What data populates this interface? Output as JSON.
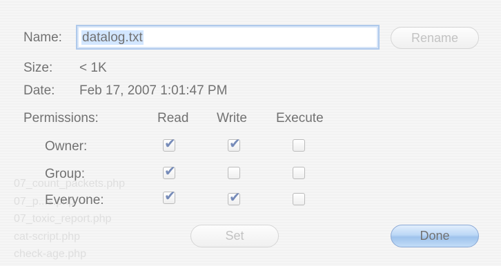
{
  "dialog": {
    "name_label": "Name:",
    "name_value": "datalog.txt",
    "rename_label": "Rename",
    "size_label": "Size:",
    "size_value": "< 1K",
    "date_label": "Date:",
    "date_value": "Feb 17, 2007 1:01:47 PM",
    "permissions_label": "Permissions:",
    "columns": [
      "Read",
      "Write",
      "Execute"
    ],
    "rows": [
      {
        "label": "Owner:",
        "read": true,
        "write": true,
        "execute": false
      },
      {
        "label": "Group:",
        "read": true,
        "write": false,
        "execute": false
      },
      {
        "label": "Everyone:",
        "read": true,
        "write": true,
        "execute": false
      }
    ],
    "set_label": "Set",
    "done_label": "Done"
  },
  "background": {
    "files": [
      "07_count_packets.php",
      "07_p...s.php",
      "07_toxic_report.php",
      "cat-script.php",
      "check-age.php"
    ]
  },
  "colors": {
    "accent": "#5f9be0",
    "field_focus": "#7aa6de",
    "check": "#1b3f8a"
  }
}
